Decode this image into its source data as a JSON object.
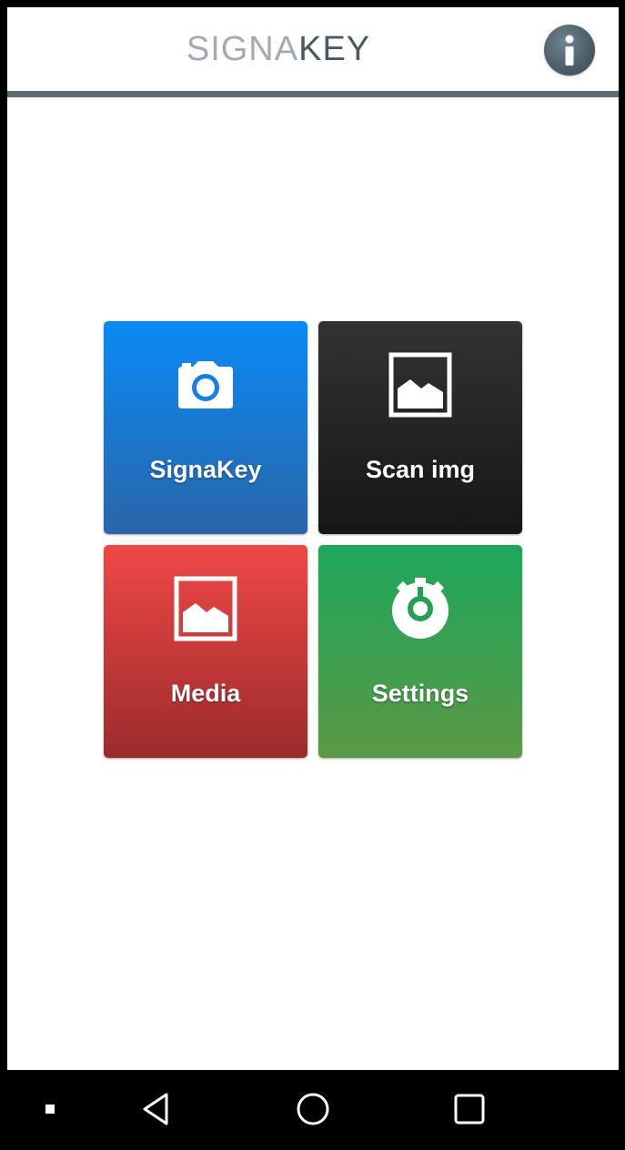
{
  "header": {
    "logo_part1": "SIGNA",
    "logo_part2": "KEY",
    "info_icon": "info-icon",
    "line_color": "#5c6d75"
  },
  "tiles": [
    {
      "label": "SignaKey",
      "icon": "camera-icon",
      "color": "#1877d4"
    },
    {
      "label": "Scan img",
      "icon": "image-icon",
      "color": "#222222"
    },
    {
      "label": "Media",
      "icon": "image-icon",
      "color": "#d63c3c"
    },
    {
      "label": "Settings",
      "icon": "gear-icon",
      "color": "#2aa050"
    }
  ],
  "navbar": {
    "icons": [
      "menu-dot-icon",
      "back-icon",
      "home-icon",
      "recents-icon"
    ]
  }
}
